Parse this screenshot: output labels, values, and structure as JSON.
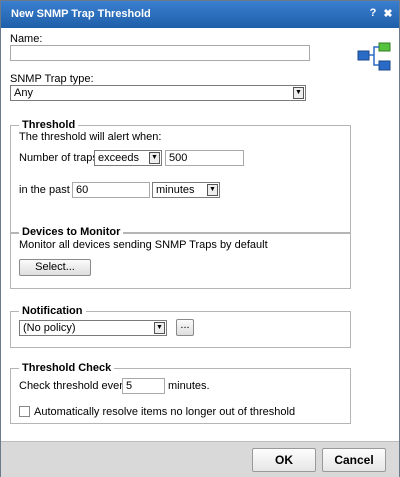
{
  "window": {
    "title": "New SNMP Trap Threshold",
    "help_label": "?",
    "close_label": "✖"
  },
  "name": {
    "label": "Name:",
    "value": ""
  },
  "trap_type": {
    "label": "SNMP Trap type:",
    "value": "Any"
  },
  "threshold": {
    "legend": "Threshold",
    "description": "The threshold will alert when:",
    "number_label": "Number of traps",
    "operator": "exceeds",
    "count": "500",
    "past_label": "in the past",
    "period_value": "60",
    "period_unit": "minutes"
  },
  "devices": {
    "legend": "Devices to Monitor",
    "description": "Monitor all devices sending SNMP Traps by default",
    "select_label": "Select..."
  },
  "notification": {
    "legend": "Notification",
    "policy": "(No policy)",
    "browse_label": "..."
  },
  "check": {
    "legend": "Threshold Check",
    "every_label": "Check threshold every",
    "every_value": "5",
    "unit": "minutes.",
    "auto_resolve_label": "Automatically resolve items no longer out of threshold",
    "auto_resolve_checked": false
  },
  "footer": {
    "ok_label": "OK",
    "cancel_label": "Cancel"
  }
}
